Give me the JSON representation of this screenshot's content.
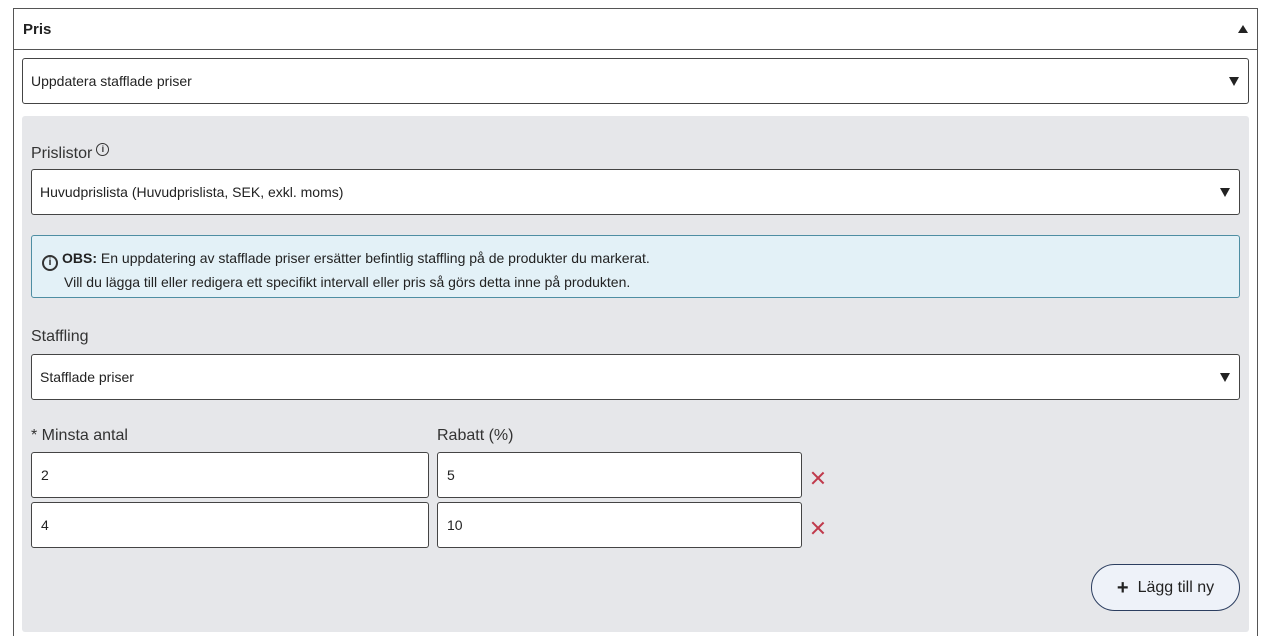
{
  "panel": {
    "title": "Pris"
  },
  "action_select": {
    "value": "Uppdatera stafflade priser"
  },
  "pricelists": {
    "label": "Prislistor",
    "value": "Huvudprislista (Huvudprislista, SEK, exkl. moms)"
  },
  "notice": {
    "bold": "OBS:",
    "line1": "En uppdatering av stafflade priser ersätter befintlig staffling på de produkter du markerat.",
    "line2": "Vill du lägga till eller redigera ett specifikt intervall eller pris så görs detta inne på produkten."
  },
  "staffling": {
    "label": "Staffling",
    "value": "Stafflade priser"
  },
  "tiers": {
    "min_label": "* Minsta antal",
    "discount_label": "Rabatt (%)",
    "rows": [
      {
        "min": "2",
        "discount": "5"
      },
      {
        "min": "4",
        "discount": "10"
      }
    ]
  },
  "add_button": {
    "label": "Lägg till ny"
  }
}
